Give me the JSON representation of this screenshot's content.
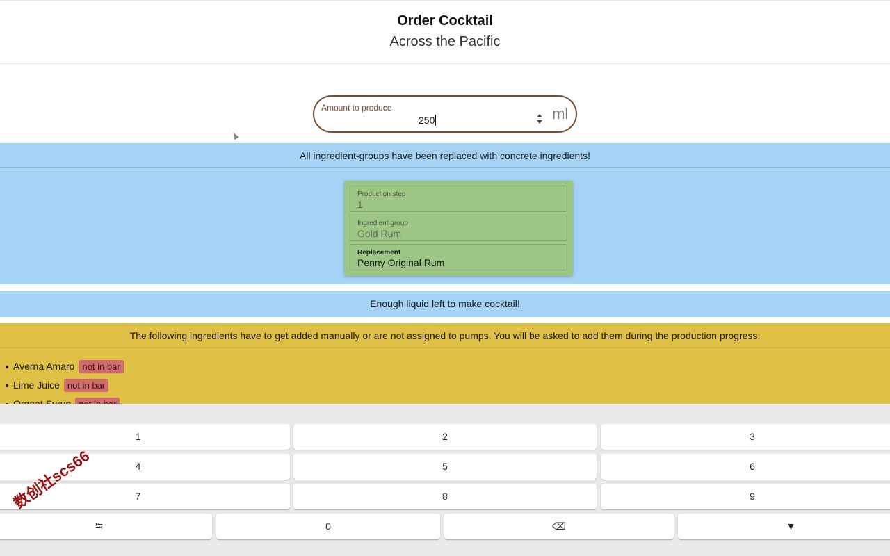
{
  "header": {
    "title": "Order Cocktail",
    "subtitle": "Across the Pacific"
  },
  "amount": {
    "label": "Amount to produce",
    "value": "250",
    "unit": "ml"
  },
  "replacement_section": {
    "message": "All ingredient-groups have been replaced with concrete ingredients!",
    "card": {
      "production_step_label": "Production step",
      "production_step_value": "1",
      "ingredient_group_label": "Ingredient group",
      "ingredient_group_value": "Gold Rum",
      "replacement_label": "Replacement",
      "replacement_value": "Penny Original Rum"
    }
  },
  "liquid_status": "Enough liquid left to make cocktail!",
  "manual_section": {
    "message": "The following ingredients have to get added manually or are not assigned to pumps. You will be asked to add them during the production progress:",
    "ingredients": [
      {
        "name": "Averna Amaro",
        "badge": "not in bar"
      },
      {
        "name": "Lime Juice",
        "badge": "not in bar"
      },
      {
        "name": "Orgeat Syrup",
        "badge": "not in bar"
      }
    ]
  },
  "keyboard": {
    "keys": [
      "1",
      "2",
      "3",
      "4",
      "5",
      "6",
      "7",
      "8",
      "9"
    ],
    "bottom_keys": [
      "⭾",
      "0",
      "⌫",
      "▼"
    ]
  },
  "watermark": "数创社scs66",
  "colors": {
    "info_blue": "#a5d3f5",
    "warning_yellow": "#e0bf45",
    "card_green": "#9dc584",
    "badge_red": "#d06b6b",
    "input_border": "#7a4b2a"
  }
}
